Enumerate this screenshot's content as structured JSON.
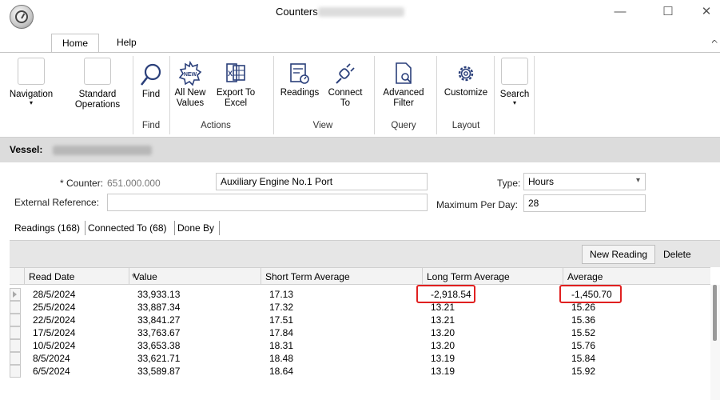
{
  "window": {
    "title": "Counters",
    "controls": {
      "minimize": "—",
      "maximize": "☐",
      "close": "✕"
    }
  },
  "ribbon_tabs": [
    {
      "label": "Home",
      "active": true
    },
    {
      "label": "Help",
      "active": false
    }
  ],
  "ribbon": {
    "collapse_glyph": "ᨈ",
    "buttons": {
      "navigation": "Navigation",
      "standard_operations": "Standard\nOperations",
      "find": "Find",
      "all_new_values": "All New\nValues",
      "export_to_excel": "Export To\nExcel",
      "readings": "Readings",
      "connect_to": "Connect\nTo",
      "advanced_filter": "Advanced\nFilter",
      "customize": "Customize",
      "search": "Search"
    },
    "groups": {
      "find": "Find",
      "actions": "Actions",
      "view": "View",
      "query": "Query",
      "layout": "Layout"
    }
  },
  "vessel": {
    "label": "Vessel:"
  },
  "form": {
    "counter_label": "* Counter:",
    "counter_code": "651.000.000",
    "counter_name": "Auxiliary Engine No.1 Port",
    "type_label": "Type:",
    "type_value": "Hours",
    "external_reference_label": "External Reference:",
    "external_reference_value": "",
    "max_per_day_label": "Maximum Per Day:",
    "max_per_day_value": "28"
  },
  "detail_tabs": [
    {
      "label": "Readings (168)",
      "active": true
    },
    {
      "label": "Connected To (68)",
      "active": false
    },
    {
      "label": "Done By",
      "active": false
    }
  ],
  "grid_toolbar": {
    "new_reading": "New Reading",
    "delete": "Delete"
  },
  "grid": {
    "columns": [
      "Read Date",
      "Value",
      "Short Term Average",
      "Long Term Average",
      "Average"
    ],
    "rows": [
      [
        "28/5/2024",
        "33,933.13",
        "17.13",
        "-2,918.54",
        "-1,450.70"
      ],
      [
        "25/5/2024",
        "33,887.34",
        "17.32",
        "13.21",
        "15.26"
      ],
      [
        "22/5/2024",
        "33,841.27",
        "17.51",
        "13.21",
        "15.36"
      ],
      [
        "17/5/2024",
        "33,763.67",
        "17.84",
        "13.20",
        "15.52"
      ],
      [
        "10/5/2024",
        "33,653.38",
        "18.31",
        "13.20",
        "15.76"
      ],
      [
        "8/5/2024",
        "33,621.71",
        "18.48",
        "13.19",
        "15.84"
      ],
      [
        "6/5/2024",
        "33,589.87",
        "18.64",
        "13.19",
        "15.92"
      ]
    ]
  }
}
